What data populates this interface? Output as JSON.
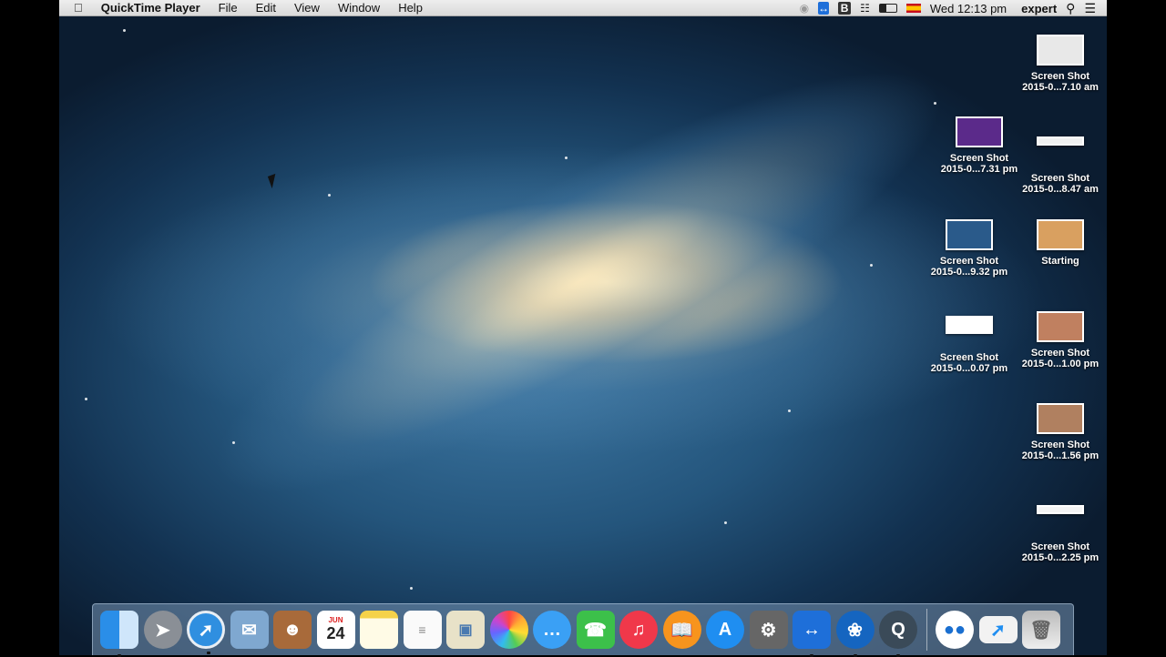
{
  "menubar": {
    "app": "QuickTime Player",
    "items": [
      "File",
      "Edit",
      "View",
      "Window",
      "Help"
    ],
    "clock": "Wed 12:13 pm",
    "user": "expert"
  },
  "desktop": [
    {
      "line1": "Screen Shot",
      "line2": "2015-0...7.10 am",
      "thumb": "#e8e8e8"
    },
    {
      "line1": "Screen Shot",
      "line2": "2015-0...7.31 pm",
      "thumb": "#5b2a8a"
    },
    {
      "line1": "Screen Shot",
      "line2": "2015-0...8.47 am",
      "thumb": "#f0f0f0"
    },
    {
      "line1": "Screen Shot",
      "line2": "2015-0...9.32 pm",
      "thumb": "#2a5a8a"
    },
    {
      "line1": "Starting",
      "line2": "",
      "thumb": "#d9a060"
    },
    {
      "line1": "Screen Shot",
      "line2": "2015-0...0.07 pm",
      "thumb": "#ffffff"
    },
    {
      "line1": "Screen Shot",
      "line2": "2015-0...1.00 pm",
      "thumb": "#c08060"
    },
    {
      "line1": "Screen Shot",
      "line2": "2015-0...1.56 pm",
      "thumb": "#b08060"
    },
    {
      "line1": "Screen Shot",
      "line2": "2015-0...2.25 pm",
      "thumb": "#f4f4f4"
    }
  ],
  "dock": {
    "calendar_month": "JUN",
    "calendar_day": "24"
  }
}
